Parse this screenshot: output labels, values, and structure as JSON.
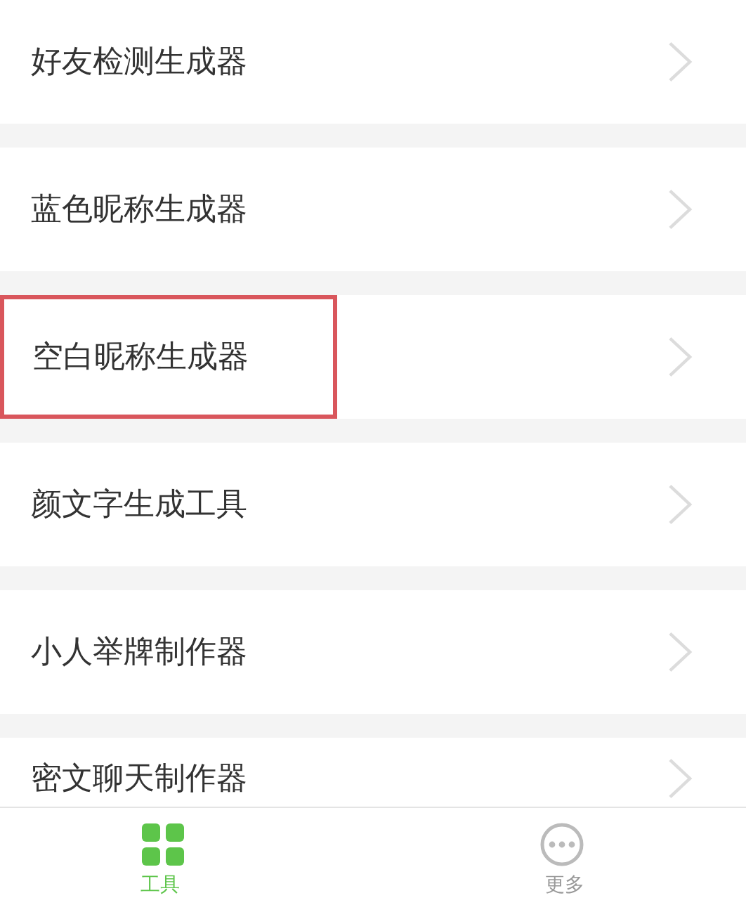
{
  "items": [
    {
      "label": "好友检测生成器",
      "highlighted": false
    },
    {
      "label": "蓝色昵称生成器",
      "highlighted": false
    },
    {
      "label": "空白昵称生成器",
      "highlighted": true
    },
    {
      "label": "颜文字生成工具",
      "highlighted": false
    },
    {
      "label": "小人举牌制作器",
      "highlighted": false
    },
    {
      "label": "密文聊天制作器",
      "highlighted": false
    }
  ],
  "tab_bar": [
    {
      "label": "工具",
      "kind": "grid",
      "selected": true
    },
    {
      "label": "更多",
      "kind": "more",
      "selected": false
    }
  ]
}
